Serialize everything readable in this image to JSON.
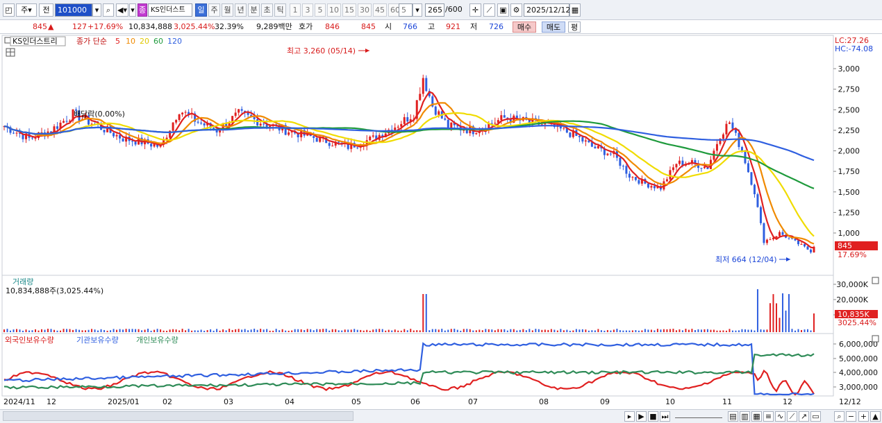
{
  "toolbar": {
    "period_unit": "주",
    "prev_label": "전",
    "code_value": "101000",
    "stock_name": "KS인더스트",
    "tabs": [
      {
        "label": "일",
        "active": true
      },
      {
        "label": "주",
        "active": false
      },
      {
        "label": "월",
        "active": false
      },
      {
        "label": "년",
        "active": false
      },
      {
        "label": "분",
        "active": false
      },
      {
        "label": "초",
        "active": false
      },
      {
        "label": "틱",
        "active": false
      }
    ],
    "intervals": [
      "1",
      "3",
      "5",
      "10",
      "15",
      "30",
      "45",
      "60"
    ],
    "interval_selected": "5",
    "count": "265",
    "count_total": "/600",
    "date": "2025/12/12",
    "badge": "종"
  },
  "quote": {
    "price": "845",
    "change_arrow": "▲",
    "change": "127",
    "change_pct": "+17.69%",
    "volume": "10,834,888",
    "volume_ratio": "3,025.44%",
    "turnover": "32.39%",
    "amount": "9,289백만",
    "quote_label": "호가",
    "ask": "846",
    "bid": "845",
    "open_label": "시",
    "open": "766",
    "high_label": "고",
    "high": "921",
    "low_label": "저",
    "low": "726",
    "buy_label": "매수",
    "sell_label": "매도",
    "eval_label": "평"
  },
  "price_panel": {
    "name_label": "KS인더스트리",
    "series_label": "종가 단순",
    "ma_labels": [
      "5",
      "10",
      "20",
      "60",
      "120"
    ],
    "ma_colors": [
      "#e02020",
      "#f08a00",
      "#f0dc00",
      "#1e9a3c",
      "#2f5fe0"
    ],
    "lc_label": "LC:27.26",
    "hc_label": "HC:-74.08",
    "high_annotation": "최고 3,260 (05/14)",
    "low_annotation": "최저 664 (12/04)",
    "ex_dividend": "배당락(0.00%)",
    "current_price_tag": "845",
    "current_pct_tag": "17.69%",
    "y_ticks": [
      "3,000",
      "2,750",
      "2,500",
      "2,250",
      "2,000",
      "1,750",
      "1,500",
      "1,250",
      "1,000"
    ]
  },
  "volume_panel": {
    "label": "거래량",
    "value_label": "10,834,888주(3,025.44%)",
    "y_ticks": [
      "30,000K",
      "20,000K",
      "10,000K"
    ],
    "current_tag": "10,835K",
    "current_pct_tag": "3025.44%"
  },
  "holdings_panel": {
    "legend": [
      "외국인보유수량",
      "기관보유수량",
      "개인보유수량"
    ],
    "y_ticks": [
      "6,000,000",
      "5,000,000",
      "4,000,000",
      "3,000,000"
    ]
  },
  "x_axis": [
    "2024/11",
    "12",
    "2025/01",
    "02",
    "03",
    "04",
    "05",
    "06",
    "07",
    "08",
    "09",
    "10",
    "11",
    "12"
  ],
  "x_axis_right": "12/12",
  "chart_data": {
    "type": "candlestick",
    "y_range": [
      664,
      3260
    ],
    "price_high": {
      "value": 3260,
      "date": "05/14"
    },
    "price_low": {
      "value": 664,
      "date": "12/04"
    },
    "last_close": 845,
    "moving_averages": [
      "5",
      "10",
      "20",
      "60",
      "120"
    ]
  }
}
